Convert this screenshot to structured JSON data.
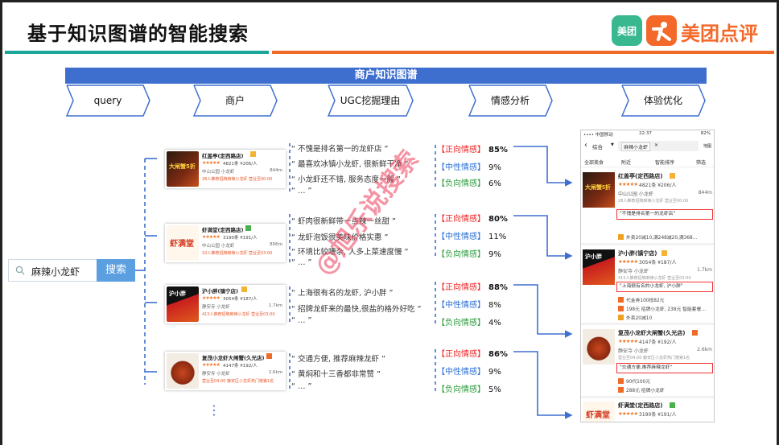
{
  "title": "基于知识图谱的智能搜索",
  "brand": {
    "square_text": "美团",
    "name": "美团点评"
  },
  "colors": {
    "teal": "#1aa79a",
    "orange": "#f06a28",
    "blue": "#3e6fcf",
    "positive": "#e22222",
    "neutral": "#2a6fd6",
    "negative": "#2a9a3a"
  },
  "banner": "商户知识图谱",
  "pipeline": [
    "query",
    "商户",
    "UGC挖掘理由",
    "情感分析",
    "体验优化"
  ],
  "search": {
    "query": "麻辣小龙虾",
    "button": "搜索"
  },
  "shops": [
    {
      "name": "红盖亭(定西路店)",
      "rating": "4821条 ¥206/人",
      "loc": "中山公园 小龙虾",
      "dist": "844m",
      "tag": "28人推荐招牌麻辣小龙虾  营业至00:00",
      "img_text": "大闸蟹5折"
    },
    {
      "name": "虾满堂(定西路店)",
      "rating": "3190条 ¥191/人",
      "loc": "中山公园 小龙虾",
      "dist": "806m",
      "tag": "10人推荐招牌麻辣小龙虾  营业至03:00",
      "img_text": "虾满堂"
    },
    {
      "name": "沪小胖(镇宁店)",
      "rating": "3054条 ¥187/人",
      "loc": "静安寺 小龙虾",
      "dist": "1.7km",
      "tag": "415人推荐招牌麻辣小龙虾  营业至03:00",
      "img_text": "沪小胖"
    },
    {
      "name": "复茂小龙虾大闸蟹(久光店)",
      "rating": "4147条 ¥192/人",
      "loc": "静安寺 小龙虾",
      "dist": "2.6km",
      "tag": "营业至04:00  静安区小龙虾热门榜第1名",
      "img_text": ""
    }
  ],
  "reviews": [
    [
      "不愧是排名第一的龙虾店",
      "最喜欢冰镇小龙虾, 很新鲜干净",
      "小龙虾还不错, 服务态度一般",
      "…"
    ],
    [
      "虾肉很新鲜带一点辣一丝甜",
      "龙虾泡饭很美味价格实惠",
      "环境比较嘈杂, 人多上菜速度慢",
      "…"
    ],
    [
      "上海很有名的龙虾, 沪小胖",
      "招牌龙虾来的最快,很盐的格外好吃",
      "…"
    ],
    [
      "交通方便, 推荐麻辣龙虾",
      "黄焖和十三香都非常赞",
      "…"
    ]
  ],
  "sentiment_labels": {
    "pos": "【正向情感】",
    "neu": "【中性情感】",
    "neg": "【负向情感】"
  },
  "sentiments": [
    {
      "pos": "85%",
      "neu": "9%",
      "neg": "6%"
    },
    {
      "pos": "80%",
      "neu": "11%",
      "neg": "9%"
    },
    {
      "pos": "88%",
      "neu": "8%",
      "neg": "4%"
    },
    {
      "pos": "86%",
      "neu": "9%",
      "neg": "5%"
    }
  ],
  "watermark": "@旭乐说搜索",
  "ellipsis": "⋮",
  "phone": {
    "status_left": "•••• 中国移动",
    "status_time": "22:37",
    "status_right": "82%",
    "search_cat": "综合",
    "search_query": "麻辣小龙虾",
    "map_label": "地图",
    "filters": [
      "全部美食",
      "附近",
      "智能排序",
      "筛选"
    ],
    "items": [
      {
        "name": "红盖亭(定西路店)",
        "rating": "4821条 ¥206/人",
        "loc": "中山公园 小龙虾",
        "dist": "844m",
        "tag": "28人推荐招牌麻辣小龙虾 营业至00:00",
        "quote": "\"不愧是排名第一的龙虾店\"",
        "extra": "外卖20减10,满248减20,满368…",
        "img_text": "大闸蟹5折"
      },
      {
        "name": "沪小胖(镇宁店)",
        "rating": "3054条 ¥187/人",
        "loc": "静安寺 小龙虾",
        "dist": "1.7km",
        "tag": "415人推荐招牌麻辣小龙虾 营业至03:00",
        "quote": "\"上海很有名的小龙虾, 沪小胖\"",
        "extra": "代金券100抵82元",
        "extra2": "198元 招牌小龙虾, 238元 智能套餐…",
        "extra3": "外卖20减10",
        "img_text": "沪小胖"
      },
      {
        "name": "复茂小龙虾大闸蟹(久光店)",
        "rating": "4147条 ¥192/人",
        "loc": "静安寺 小龙虾",
        "dist": "2.6km",
        "tag": "营业至04:00 静安区小龙虾热门榜第1名",
        "quote": "\"交通方便,推荐麻辣龙虾\"",
        "extra": "90代100元",
        "extra2": "288元 招牌小龙虾",
        "img_text": ""
      },
      {
        "name": "虾满堂(定西路店)",
        "rating": "3190条 ¥191/人",
        "img_text": "虾满堂"
      }
    ]
  },
  "stars": "★★★★★"
}
